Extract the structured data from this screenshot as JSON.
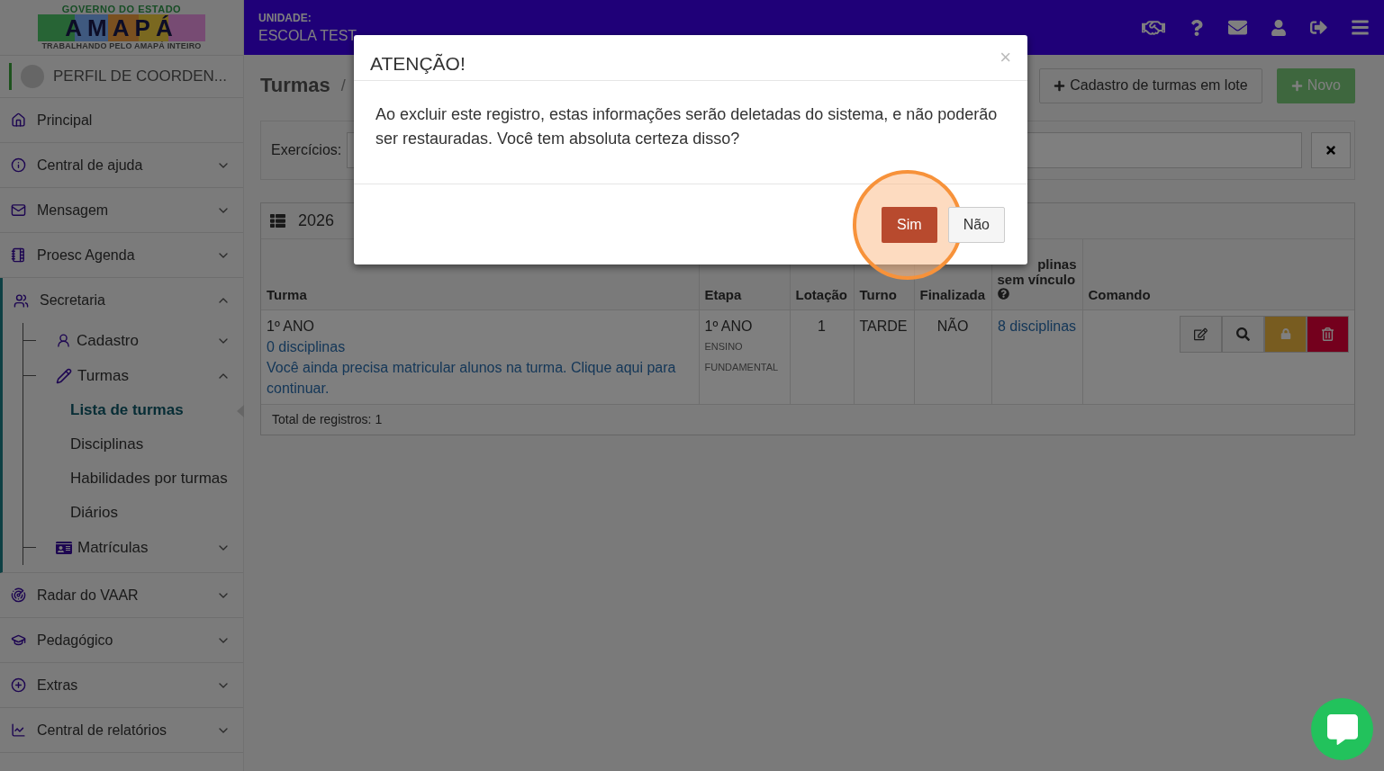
{
  "header": {
    "logo": {
      "top": "GOVERNO DO ESTADO",
      "wordmark": "AMAPÁ",
      "bottom": "TRABALHANDO PELO AMAPÁ INTEIRO"
    },
    "unit_label": "UNIDADE:",
    "unit_name": "ESCOLA TEST"
  },
  "profile": {
    "name": "PERFIL DE COORDEN..."
  },
  "sidebar": {
    "items": [
      {
        "label": "Principal",
        "kind": "link"
      },
      {
        "label": "Central de ajuda",
        "kind": "group",
        "expanded": false
      },
      {
        "label": "Mensagem",
        "kind": "group",
        "expanded": false
      },
      {
        "label": "Proesc Agenda",
        "kind": "group",
        "expanded": false
      },
      {
        "label": "Secretaria",
        "kind": "group",
        "expanded": true,
        "children": [
          {
            "label": "Cadastro",
            "kind": "group",
            "expanded": false
          },
          {
            "label": "Turmas",
            "kind": "group",
            "expanded": true,
            "children": [
              {
                "label": "Lista de turmas",
                "kind": "page",
                "selected": true
              },
              {
                "label": "Disciplinas",
                "kind": "page",
                "selected": false
              },
              {
                "label": "Habilidades por turmas",
                "kind": "page",
                "selected": false
              },
              {
                "label": "Diários",
                "kind": "page",
                "selected": false
              }
            ]
          },
          {
            "label": "Matrículas",
            "kind": "group",
            "expanded": false
          }
        ]
      },
      {
        "label": "Radar do VAAR",
        "kind": "group",
        "expanded": false
      },
      {
        "label": "Pedagógico",
        "kind": "group",
        "expanded": false
      },
      {
        "label": "Extras",
        "kind": "group",
        "expanded": false
      },
      {
        "label": "Central de relatórios",
        "kind": "group",
        "expanded": false
      }
    ]
  },
  "page": {
    "breadcrumb": [
      "Turmas",
      "/"
    ],
    "actions": [
      {
        "label": "Cadastro de turmas em lote",
        "kind": "default"
      },
      {
        "label": "Novo",
        "kind": "success"
      }
    ],
    "filter": {
      "label": "Exercícios:"
    }
  },
  "table": {
    "title": "2026",
    "columns": [
      {
        "lines": [
          "Turma"
        ],
        "kind": "plain"
      },
      {
        "lines": [
          "Etapa"
        ],
        "kind": "plain"
      },
      {
        "lines": [
          "Lotação"
        ],
        "kind": "plain"
      },
      {
        "lines": [
          "Turno"
        ],
        "kind": "plain"
      },
      {
        "lines": [
          "Finalizada"
        ],
        "kind": "plain"
      },
      {
        "lines": [
          "plinas",
          "sem vínculo"
        ],
        "kind": "help"
      },
      {
        "lines": [
          "Comando"
        ],
        "kind": "plain"
      }
    ],
    "rows": [
      {
        "turma": "1º ANO",
        "disciplinas": "0 disciplinas",
        "notice": "Você ainda precisa matricular alunos na turma. Clique aqui para continuar.",
        "etapa": "1º ANO",
        "etapa_sub": "ENSINO FUNDAMENTAL",
        "lotacao": "1",
        "turno": "TARDE",
        "finalizada": "NÃO",
        "sem_vinculo": "8 disciplinas",
        "commands": [
          {
            "kind": "edit"
          },
          {
            "kind": "search"
          },
          {
            "kind": "lock"
          },
          {
            "kind": "delete"
          }
        ]
      }
    ],
    "footer": "Total de registros: 1"
  },
  "modal": {
    "title": "ATENÇÃO!",
    "close": "×",
    "message": "Ao excluir este registro, estas informações serão deletadas do sistema, e não poderão ser restauradas. Você tem absoluta certeza disso?",
    "buttons": [
      {
        "label": "Sim",
        "kind": "danger",
        "highlighted": true
      },
      {
        "label": "Não",
        "kind": "default",
        "highlighted": false
      }
    ]
  }
}
